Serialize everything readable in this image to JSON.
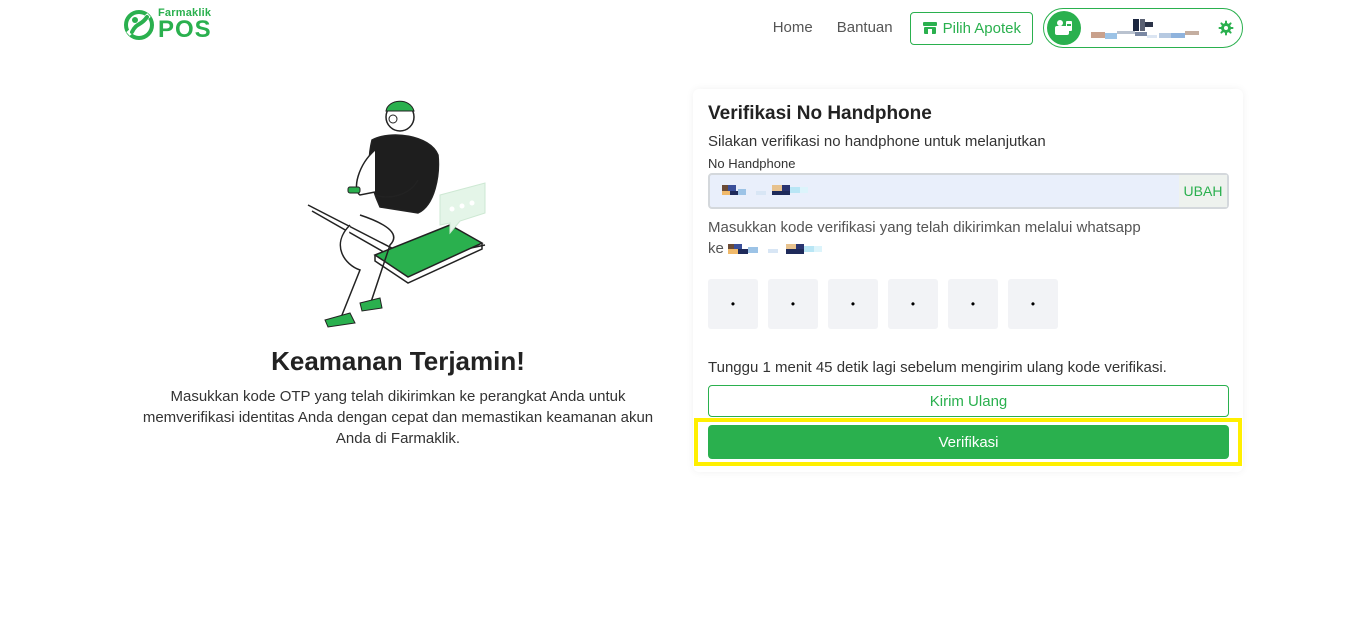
{
  "header": {
    "logo_small": "Farmaklik",
    "logo_big": "POS",
    "nav": [
      {
        "label": "Home"
      },
      {
        "label": "Bantuan"
      }
    ],
    "pilih_apotek_label": "Pilih Apotek",
    "user_name_masked": "",
    "colors": {
      "accent": "#2ab04e"
    }
  },
  "hero": {
    "title": "Keamanan Terjamin!",
    "description": "Masukkan kode OTP yang telah dikirimkan ke perangkat Anda untuk memverifikasi identitas Anda dengan cepat dan memastikan keamanan akun Anda di Farmaklik."
  },
  "card": {
    "title": "Verifikasi No Handphone",
    "subtitle": "Silakan verifikasi no handphone untuk melanjutkan",
    "phone_label": "No Handphone",
    "phone_value": "",
    "ubah_label": "UBAH",
    "otp_message": "Masukkan kode verifikasi yang telah dikirimkan melalui whatsapp",
    "otp_message_prefix": "ke",
    "otp_boxes": [
      "•",
      "•",
      "•",
      "•",
      "•",
      "•"
    ],
    "wait_text": "Tunggu 1 menit 45 detik lagi sebelum mengirim ulang kode verifikasi.",
    "resend_label": "Kirim Ulang",
    "verify_label": "Verifikasi"
  }
}
